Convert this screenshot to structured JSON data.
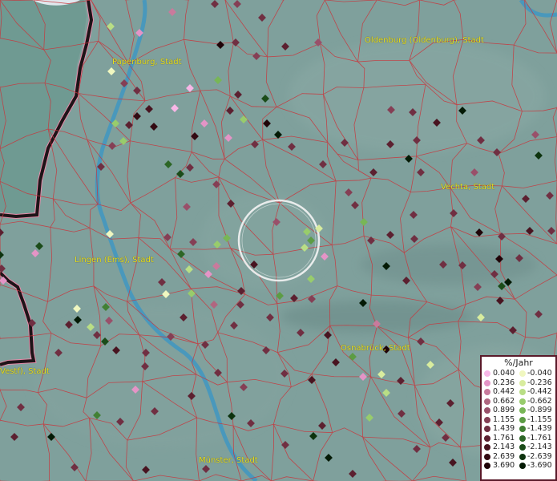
{
  "cities": [
    {
      "name": "Oldenburg (Oldenburg), Stadt"
    },
    {
      "name": "Papenburg, Stadt"
    },
    {
      "name": "Vechta, Stadt"
    },
    {
      "name": "Lingen (Ems), Stadt"
    },
    {
      "name": "Osnabrück, Stadt"
    },
    {
      "name": "Münster, Stadt"
    },
    {
      "name": "Vestf), Stadt"
    }
  ],
  "legend": {
    "title": "%/Jahr",
    "positive": [
      {
        "label": "0.040",
        "color": "#f7b6e6"
      },
      {
        "label": "0.236",
        "color": "#e494c6"
      },
      {
        "label": "0.442",
        "color": "#c97a9c"
      },
      {
        "label": "0.662",
        "color": "#b06680"
      },
      {
        "label": "0.899",
        "color": "#99506a"
      },
      {
        "label": "1.155",
        "color": "#853f55"
      },
      {
        "label": "1.439",
        "color": "#702f42"
      },
      {
        "label": "1.761",
        "color": "#5c2030"
      },
      {
        "label": "2.143",
        "color": "#481420"
      },
      {
        "label": "2.639",
        "color": "#330a12"
      },
      {
        "label": "3.690",
        "color": "#1f0308"
      }
    ],
    "negative": [
      {
        "label": "-0.040",
        "color": "#f0f7c0"
      },
      {
        "label": "-0.236",
        "color": "#d8ec9e"
      },
      {
        "label": "-0.442",
        "color": "#b9de85"
      },
      {
        "label": "-0.662",
        "color": "#98cc6c"
      },
      {
        "label": "-0.899",
        "color": "#78b656"
      },
      {
        "label": "-1.155",
        "color": "#5c9c44"
      },
      {
        "label": "-1.439",
        "color": "#428034"
      },
      {
        "label": "-1.761",
        "color": "#2d6626"
      },
      {
        "label": "-2.143",
        "color": "#1b4c19"
      },
      {
        "label": "-2.639",
        "color": "#0d330e"
      },
      {
        "label": "-3.690",
        "color": "#041a05"
      }
    ]
  }
}
